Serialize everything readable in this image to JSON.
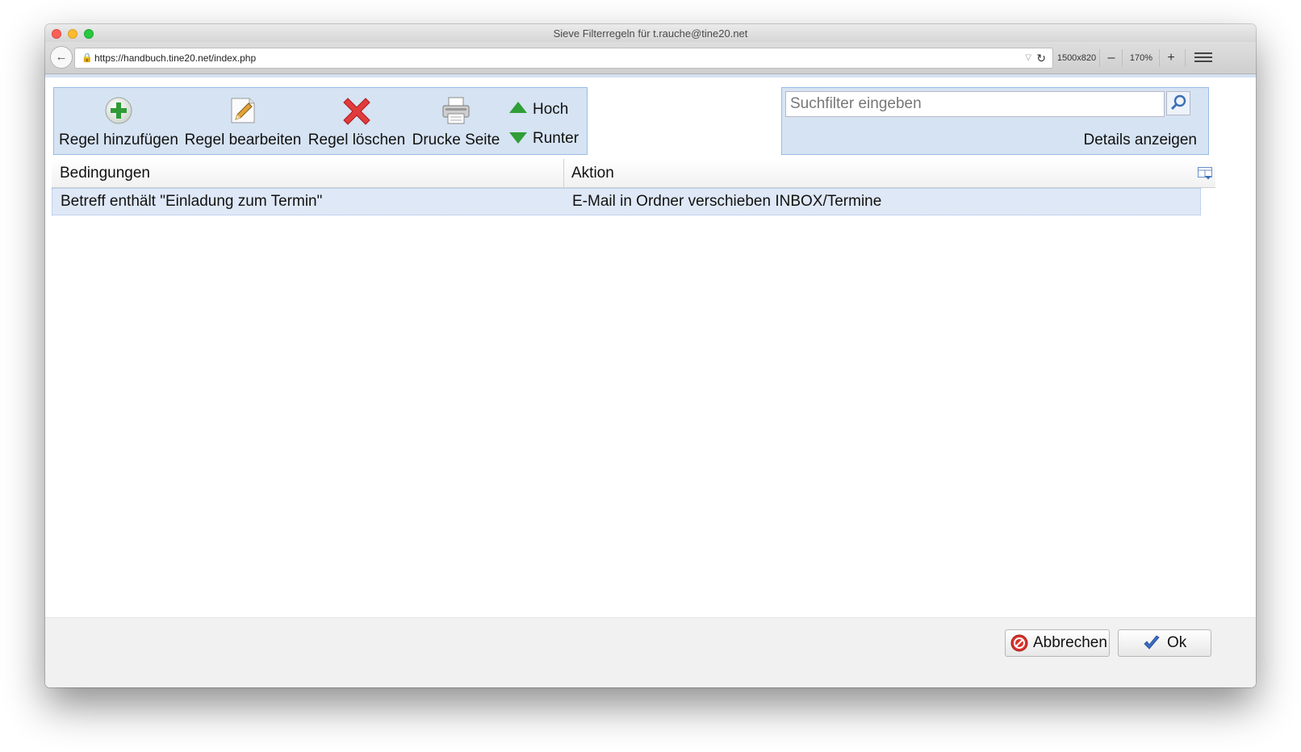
{
  "window": {
    "title": "Sieve Filterregeln für t.rauche@tine20.net"
  },
  "browser": {
    "url": "https://handbuch.tine20.net/index.php",
    "viewport": "1500x820",
    "zoom": "170%",
    "zoom_out": "–",
    "zoom_in": "+"
  },
  "toolbar": {
    "add_rule": "Regel hinzufügen",
    "edit_rule": "Regel bearbeiten",
    "delete_rule": "Regel löschen",
    "print_page": "Drucke Seite",
    "move_up": "Hoch",
    "move_down": "Runter"
  },
  "search": {
    "placeholder": "Suchfilter eingeben",
    "details": "Details anzeigen"
  },
  "grid": {
    "columns": [
      "Bedingungen",
      "Aktion"
    ],
    "rows": [
      {
        "condition": "Betreff enthält \"Einladung zum Termin\"",
        "action": "E-Mail in Ordner verschieben INBOX/Termine"
      }
    ]
  },
  "footer": {
    "cancel": "Abbrechen",
    "ok": "Ok"
  },
  "colors": {
    "toolbar_bg": "#d6e3f2",
    "toolbar_border": "#99bbe8",
    "selected_row": "#dfe8f6",
    "arrow_green": "#2f9e36",
    "delete_red": "#e23b3b"
  }
}
